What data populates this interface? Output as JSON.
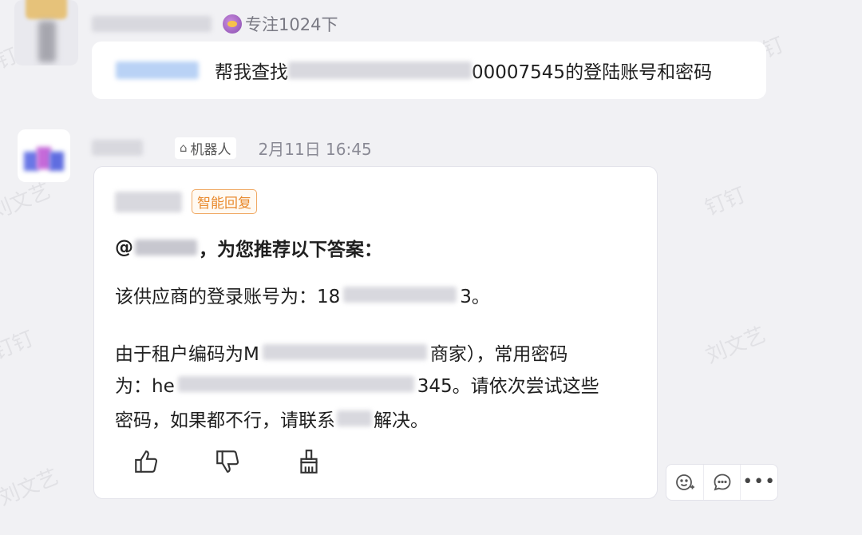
{
  "watermarks": [
    "钉钉",
    "刘文艺",
    "钉钉",
    "刘文艺",
    "钉钉",
    "钉钉",
    "刘文艺"
  ],
  "messages": [
    {
      "status_text": "专注1024下",
      "status_icon": "emoji-icon",
      "text_before": "帮我查找",
      "text_after": "00007545的登陆账号和密码"
    },
    {
      "robot_label": "机器人",
      "timestamp": "2月11日 16:45",
      "badge": "智能回复",
      "title_prefix": "@",
      "title_suffix": "，为您推荐以下答案：",
      "line1_start": "该供应商的登录账号为：18",
      "line1_end": "3。",
      "line2_start": "由于租户编码为M",
      "line2_end": "商家），常用密码",
      "line3_start": "为：he",
      "line3_end": "345。请依次尝试这些",
      "line4_start": "密码，如果都不行，请联系",
      "line4_end": "解决。"
    }
  ],
  "actions": [
    "thumbs-up-icon",
    "thumbs-down-icon",
    "broom-icon"
  ],
  "toolbar": [
    "add-reaction-icon",
    "reply-icon",
    "more-icon"
  ],
  "colors": {
    "badge": "#e98a2e",
    "background": "#f1f1f4",
    "card": "#ffffff"
  }
}
